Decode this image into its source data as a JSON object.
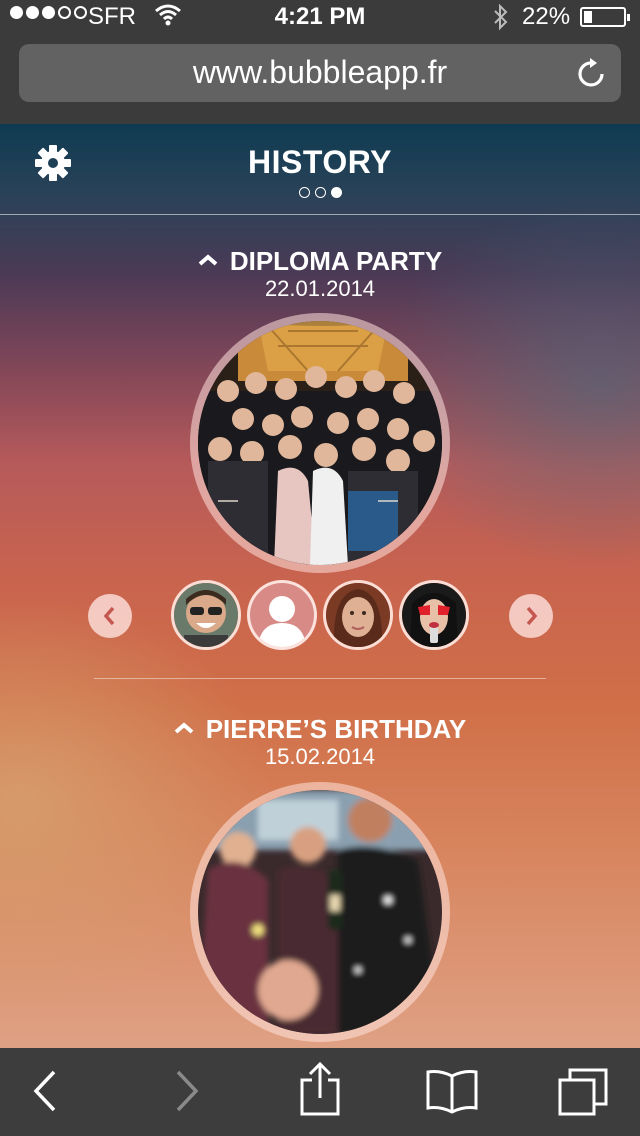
{
  "status_bar": {
    "carrier": "SFR",
    "time": "4:21 PM",
    "battery": "22%",
    "battery_level": 0.22,
    "signal_bars_filled": 3,
    "signal_bars_total": 5
  },
  "browser": {
    "url": "www.bubbleapp.fr"
  },
  "header": {
    "title": "HISTORY",
    "page_count": 3,
    "active_page": 3
  },
  "events": [
    {
      "title": "DIPLOMA PARTY",
      "date": "22.01.2014",
      "photo": "group-photo-eiffel-tower",
      "participants": [
        "friend-sunglasses",
        "default-avatar",
        "friend-woman",
        "friend-red-glasses"
      ]
    },
    {
      "title": "PIERRE’S BIRTHDAY",
      "date": "15.02.2014",
      "photo": "party-champagne-photo"
    }
  ],
  "toolbar": {
    "icons": [
      "back-icon",
      "forward-icon",
      "share-icon",
      "bookmarks-icon",
      "tabs-icon"
    ]
  },
  "colors": {
    "header_top": "#0e3b52",
    "warm_mid": "#c9644e",
    "bottom": "#dfa184",
    "bar_bg": "#3b3b3b"
  }
}
